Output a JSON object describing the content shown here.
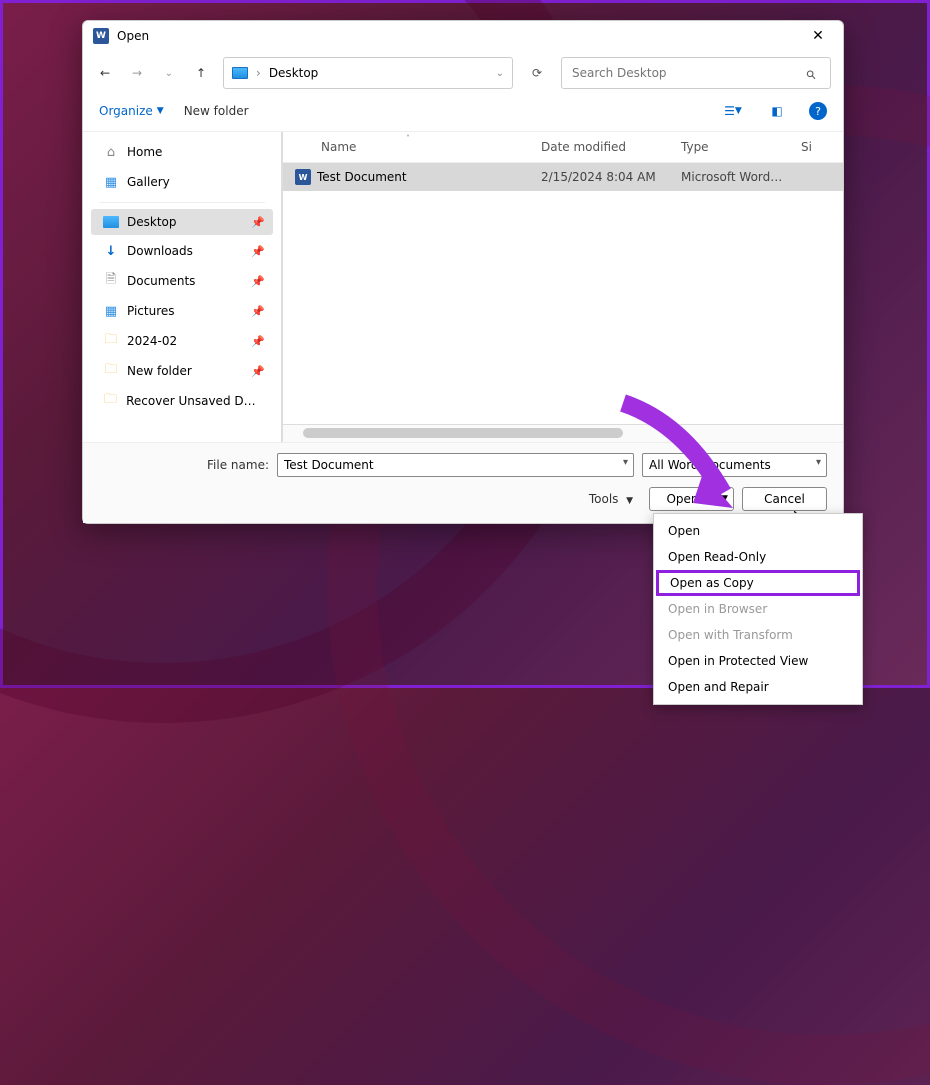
{
  "title": "Open",
  "breadcrumb": {
    "location": "Desktop"
  },
  "search": {
    "placeholder": "Search Desktop"
  },
  "toolbar": {
    "organize": "Organize",
    "newfolder": "New folder"
  },
  "sidebar": {
    "items": [
      {
        "label": "Home",
        "icon": "home"
      },
      {
        "label": "Gallery",
        "icon": "gallery"
      },
      {
        "label": "Desktop",
        "icon": "desktop",
        "selected": true,
        "pinned": true
      },
      {
        "label": "Downloads",
        "icon": "download",
        "pinned": true
      },
      {
        "label": "Documents",
        "icon": "document",
        "pinned": true
      },
      {
        "label": "Pictures",
        "icon": "picture",
        "pinned": true
      },
      {
        "label": "2024-02",
        "icon": "folder",
        "pinned": true
      },
      {
        "label": "New folder",
        "icon": "folder",
        "pinned": true
      },
      {
        "label": "Recover Unsaved Doc...",
        "icon": "folder",
        "pinned": true
      }
    ]
  },
  "columns": {
    "name": "Name",
    "date": "Date modified",
    "type": "Type",
    "size": "Si"
  },
  "files": [
    {
      "name": "Test Document",
      "date": "2/15/2024 8:04 AM",
      "type": "Microsoft Word D...",
      "selected": true
    }
  ],
  "filename": {
    "label": "File name:",
    "value": "Test Document"
  },
  "filter": {
    "value": "All Word Documents"
  },
  "buttons": {
    "tools": "Tools",
    "open": "Open",
    "cancel": "Cancel"
  },
  "menu": {
    "items": [
      {
        "label": "Open"
      },
      {
        "label": "Open Read-Only"
      },
      {
        "label": "Open as Copy",
        "highlighted": true
      },
      {
        "label": "Open in Browser",
        "disabled": true
      },
      {
        "label": "Open with Transform",
        "disabled": true
      },
      {
        "label": "Open in Protected View"
      },
      {
        "label": "Open and Repair"
      }
    ]
  }
}
